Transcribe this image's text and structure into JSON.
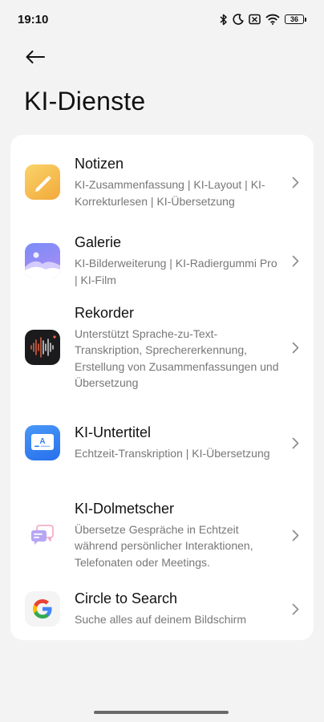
{
  "status_bar": {
    "time": "19:10",
    "battery": "36",
    "icons": [
      "bluetooth-icon",
      "do-not-disturb-moon-icon",
      "no-sim-icon",
      "wifi-icon",
      "battery-icon"
    ]
  },
  "header": {
    "back_icon": "arrow-left-icon",
    "title": "KI-Dienste"
  },
  "services": [
    {
      "title": "Notizen",
      "subtitle": "KI-Zusammenfassung | KI-Layout | KI-Korrekturlesen | KI-Übersetzung",
      "icon": "notes-app-icon"
    },
    {
      "title": "Galerie",
      "subtitle": "KI-Bilderweiterung | KI-Radiergummi Pro | KI-Film",
      "icon": "gallery-app-icon"
    },
    {
      "title": "Rekorder",
      "subtitle": "Unterstützt Sprache-zu-Text-Transkription, Sprechererkennung, Erstellung von Zusammenfassungen und Übersetzung",
      "icon": "recorder-app-icon"
    },
    {
      "title": "KI-Untertitel",
      "subtitle": "Echtzeit-Transkription | KI-Übersetzung",
      "icon": "subtitles-app-icon"
    },
    {
      "title": "KI-Dolmetscher",
      "subtitle": "Übersetze Gespräche in Echtzeit während persönlicher Interaktionen, Telefonaten oder Meetings.",
      "icon": "interpreter-app-icon"
    },
    {
      "title": "Circle to Search",
      "subtitle": "Suche alles auf deinem Bildschirm",
      "icon": "google-icon"
    }
  ],
  "colors": {
    "background": "#f3f3f3",
    "card": "#ffffff",
    "notes_accent": "#f6b73c",
    "gallery_accent": "#8f7cf3",
    "subtitles_accent": "#2f7ff0",
    "subtitle_text": "#777777"
  }
}
